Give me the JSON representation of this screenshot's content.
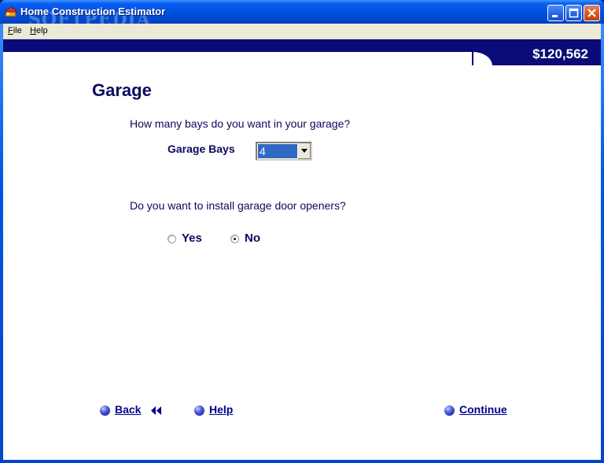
{
  "window": {
    "title": "Home Construction Estimator",
    "watermark": "SOFTPEDIA",
    "watermark_url": "www.softpedia.com"
  },
  "menu": {
    "file_key": "F",
    "file_rest": "ile",
    "help_key": "H",
    "help_rest": "elp"
  },
  "header": {
    "total": "$120,562"
  },
  "page": {
    "title": "Garage",
    "bays_question": "How many bays do you want in your garage?",
    "bays_label": "Garage Bays",
    "bays_value": "4",
    "openers_question": "Do you want to install garage door openers?",
    "openers_options": [
      "Yes",
      "No"
    ],
    "openers_selected": "No"
  },
  "nav": {
    "back": "Back",
    "help": "Help",
    "continue": "Continue"
  },
  "colors": {
    "accent": "#0a0a78",
    "text": "#0a0a5e",
    "link": "#00008b"
  }
}
